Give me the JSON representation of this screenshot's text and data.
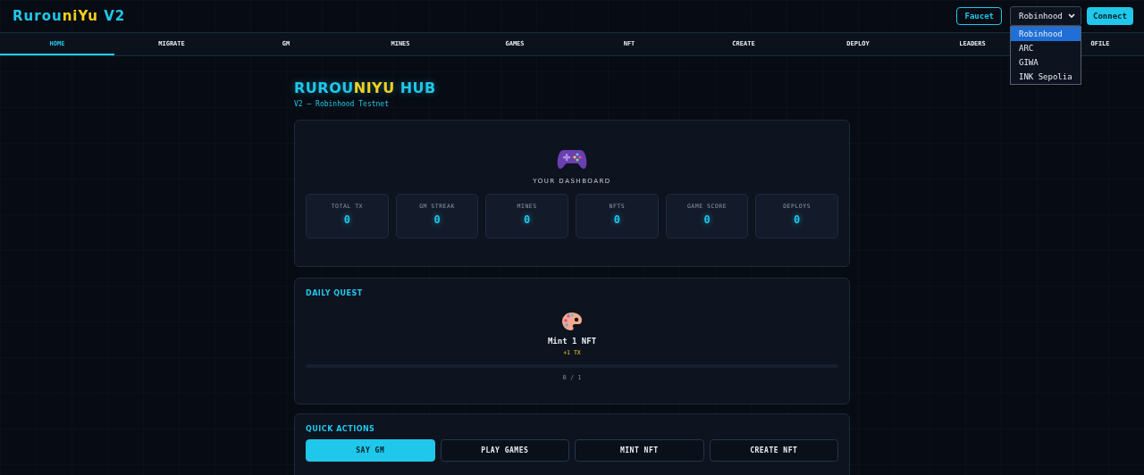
{
  "brand": {
    "parts": [
      {
        "text": "Rurou",
        "accent": false
      },
      {
        "text": "niYu",
        "accent": true
      },
      {
        "text": " V2",
        "accent": false
      }
    ]
  },
  "header": {
    "faucet": "Faucet",
    "network": {
      "value": "Robinhood",
      "expanded": true,
      "options": [
        {
          "label": "Robinhood",
          "selected": true
        },
        {
          "label": "ARC",
          "selected": false
        },
        {
          "label": "GIWA",
          "selected": false
        },
        {
          "label": "INK Sepolia",
          "selected": false
        }
      ]
    },
    "connect": "Connect"
  },
  "tabs": [
    {
      "label": "HOME",
      "selected": true
    },
    {
      "label": "MIGRATE",
      "selected": false
    },
    {
      "label": "GM",
      "selected": false
    },
    {
      "label": "MINES",
      "selected": false
    },
    {
      "label": "GAMES",
      "selected": false
    },
    {
      "label": "NFT",
      "selected": false
    },
    {
      "label": "CREATE",
      "selected": false
    },
    {
      "label": "DEPLOY",
      "selected": false
    },
    {
      "label": "LEADERS",
      "selected": false
    },
    {
      "label": "OFILE",
      "selected": false
    }
  ],
  "hero": {
    "title_parts": [
      {
        "text": "RUROU",
        "accent": false
      },
      {
        "text": "NIYU",
        "accent": true
      },
      {
        "text": " HUB",
        "accent": false
      }
    ],
    "subtitle": "V2 — Robinhood Testnet"
  },
  "dashboard": {
    "heading": "YOUR DASHBOARD",
    "stats": [
      {
        "label": "TOTAL TX",
        "value": "0"
      },
      {
        "label": "GM STREAK",
        "value": "0"
      },
      {
        "label": "MINES",
        "value": "0"
      },
      {
        "label": "NFTS",
        "value": "0"
      },
      {
        "label": "GAME SCORE",
        "value": "0"
      },
      {
        "label": "DEPLOYS",
        "value": "0"
      }
    ]
  },
  "daily_quest": {
    "heading": "DAILY QUEST",
    "task": "Mint 1 NFT",
    "reward": "+1 TX",
    "level": 0,
    "progress": "0 / 1"
  },
  "quick_actions": {
    "heading": "QUICK ACTIONS",
    "buttons": [
      {
        "label": "SAY GM",
        "primary": true
      },
      {
        "label": "PLAY GAMES",
        "primary": false
      },
      {
        "label": "MINT NFT",
        "primary": false
      },
      {
        "label": "CREATE NFT",
        "primary": false
      }
    ]
  }
}
